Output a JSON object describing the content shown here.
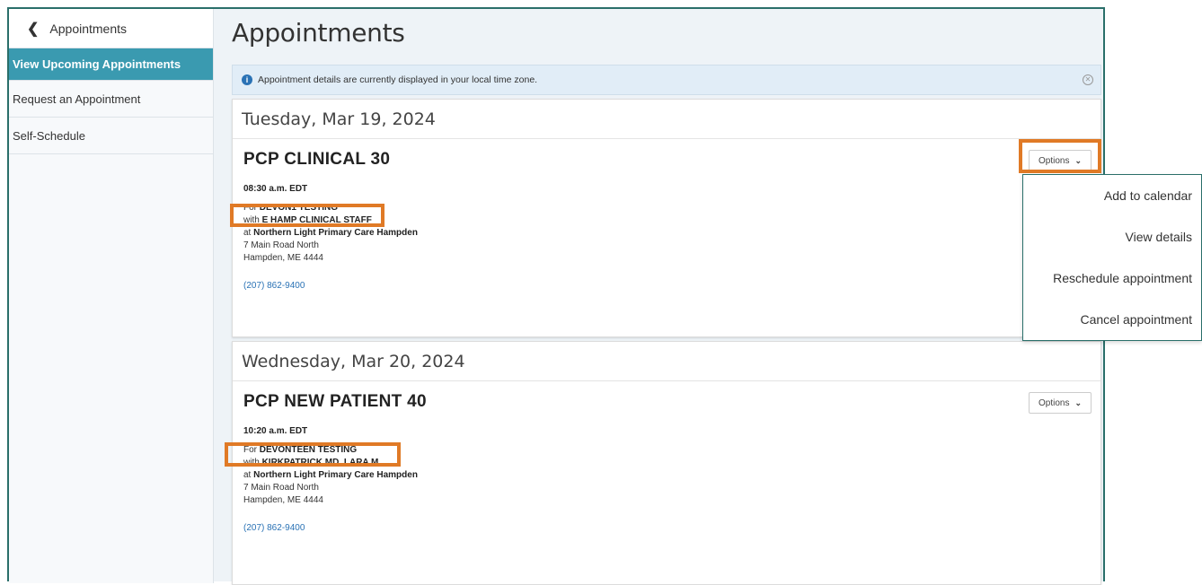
{
  "sidebar": {
    "back_label": "Appointments",
    "items": [
      {
        "label": "View Upcoming Appointments"
      },
      {
        "label": "Request an Appointment"
      },
      {
        "label": "Self-Schedule"
      }
    ]
  },
  "main": {
    "title": "Appointments",
    "banner": "Appointment details are currently displayed in your local time zone.",
    "days": [
      {
        "date": "Tuesday, Mar 19, 2024",
        "appointment": {
          "title": "PCP CLINICAL 30",
          "time": "08:30 a.m. EDT",
          "for_prefix": "For",
          "patient": "DEVON1 TESTING",
          "with_prefix": "with",
          "provider": "E HAMP CLINICAL STAFF",
          "at_prefix": "at",
          "location": "Northern Light Primary Care Hampden",
          "address1": "7 Main Road North",
          "address2": "Hampden, ME 4444",
          "phone": "(207) 862-9400",
          "options_label": "Options"
        }
      },
      {
        "date": "Wednesday, Mar 20, 2024",
        "appointment": {
          "title": "PCP NEW PATIENT 40",
          "time": "10:20 a.m. EDT",
          "for_prefix": "For",
          "patient": "DEVONTEEN TESTING",
          "with_prefix": "with",
          "provider": "KIRKPATRICK MD, LARA M",
          "at_prefix": "at",
          "location": "Northern Light Primary Care Hampden",
          "address1": "7 Main Road North",
          "address2": "Hampden, ME 4444",
          "phone": "(207) 862-9400",
          "options_label": "Options"
        }
      }
    ]
  },
  "options_menu": {
    "items": [
      "Add to calendar",
      "View details",
      "Reschedule appointment",
      "Cancel appointment"
    ]
  },
  "colors": {
    "accent": "#3a9ab0",
    "highlight": "#e07a26",
    "link": "#2a72b5",
    "frame": "#2a6f6a"
  },
  "icons": {
    "back": "chevron-left-icon",
    "info": "info-icon",
    "close": "close-circle-icon",
    "caret": "chevron-down-icon"
  }
}
